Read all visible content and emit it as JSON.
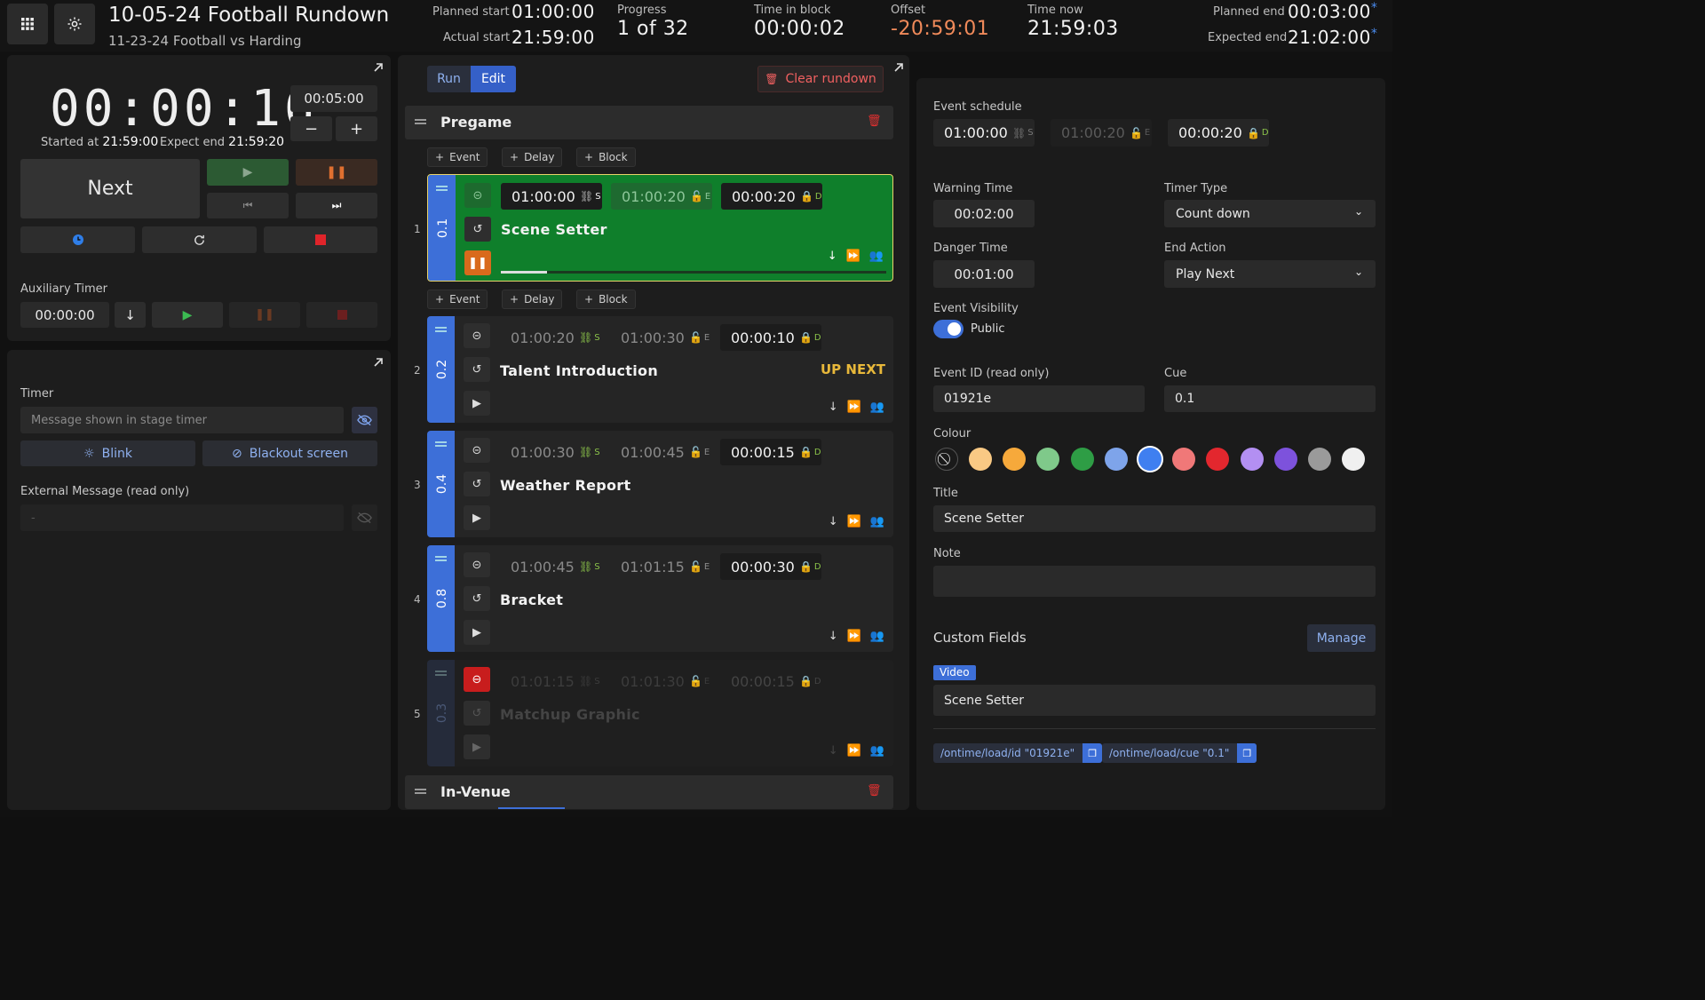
{
  "header": {
    "title": "10-05-24 Football Rundown",
    "subtitle": "11-23-24 Football vs Harding",
    "planned_start_label": "Planned start",
    "planned_start": "01:00:00",
    "actual_start_label": "Actual start",
    "actual_start": "21:59:00",
    "progress_label": "Progress",
    "progress": "1 of 32",
    "time_in_block_label": "Time in block",
    "time_in_block": "00:00:02",
    "offset_label": "Offset",
    "offset": "-20:59:01",
    "time_now_label": "Time now",
    "time_now": "21:59:03",
    "planned_end_label": "Planned end",
    "planned_end": "00:03:00",
    "expected_end_label": "Expected end",
    "expected_end": "21:02:00",
    "asterisk": "*"
  },
  "timer": {
    "main": "00:00:16",
    "started_label": "Started at",
    "started": "21:59:00",
    "expect_end_label": "Expect end",
    "expect_end": "21:59:20",
    "add_time": "00:05:00",
    "minus": "−",
    "plus": "+",
    "next": "Next",
    "aux_label": "Auxiliary Timer",
    "aux_value": "00:00:00"
  },
  "messages": {
    "timer_label": "Timer",
    "timer_placeholder": "Message shown in stage timer",
    "blink": "Blink",
    "blackout": "Blackout screen",
    "external_label": "External Message (read only)",
    "external_value": "-"
  },
  "rundown": {
    "run_tab": "Run",
    "edit_tab": "Edit",
    "clear": "Clear rundown",
    "add_event": "Event",
    "add_delay": "Delay",
    "add_block": "Block",
    "blocks": [
      "Pregame",
      "In-Venue"
    ],
    "up_next": "UP NEXT",
    "events": [
      {
        "num": "1",
        "cue": "0.1",
        "start": "01:00:00",
        "end": "01:00:20",
        "dur": "00:00:20",
        "title": "Scene Setter"
      },
      {
        "num": "2",
        "cue": "0.2",
        "start": "01:00:20",
        "end": "01:00:30",
        "dur": "00:00:10",
        "title": "Talent Introduction"
      },
      {
        "num": "3",
        "cue": "0.4",
        "start": "01:00:30",
        "end": "01:00:45",
        "dur": "00:00:15",
        "title": "Weather Report"
      },
      {
        "num": "4",
        "cue": "0.8",
        "start": "01:00:45",
        "end": "01:01:15",
        "dur": "00:00:30",
        "title": "Bracket"
      },
      {
        "num": "5",
        "cue": "0.3",
        "start": "01:01:15",
        "end": "01:01:30",
        "dur": "00:00:15",
        "title": "Matchup Graphic"
      }
    ],
    "sup_s": "S",
    "sup_e": "E",
    "sup_d": "D"
  },
  "editor": {
    "schedule_label": "Event schedule",
    "start": "01:00:00",
    "end": "01:00:20",
    "dur": "00:00:20",
    "warning_label": "Warning Time",
    "warning": "00:02:00",
    "danger_label": "Danger Time",
    "danger": "00:01:00",
    "timer_type_label": "Timer Type",
    "timer_type": "Count down",
    "end_action_label": "End Action",
    "end_action": "Play Next",
    "visibility_label": "Event Visibility",
    "visibility": "Public",
    "id_label": "Event ID (read only)",
    "id": "01921e",
    "cue_label": "Cue",
    "cue": "0.1",
    "colour_label": "Colour",
    "colours": [
      "#f9c984",
      "#f6a93b",
      "#7fc98a",
      "#2e9d45",
      "#7ea4ea",
      "#3f7ff0",
      "#f07878",
      "#e3272e",
      "#b38ff2",
      "#7d52dc",
      "#9a9a9a",
      "#f0f0f0"
    ],
    "title_label": "Title",
    "title": "Scene Setter",
    "note_label": "Note",
    "custom_fields": "Custom Fields",
    "manage": "Manage",
    "video_tag": "Video",
    "video_value": "Scene Setter",
    "osc_id": "/ontime/load/id \"01921e\"",
    "osc_cue": "/ontime/load/cue \"0.1\""
  }
}
